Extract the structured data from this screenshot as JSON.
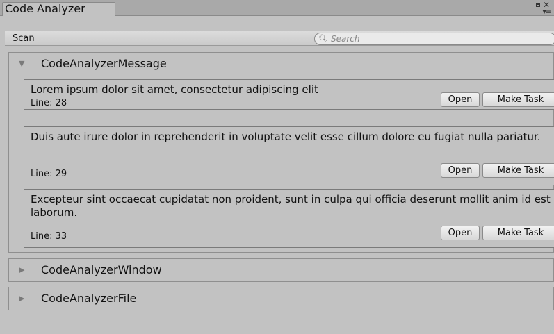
{
  "window": {
    "tab_title": "Code Analyzer",
    "icons": [
      "maximize-icon",
      "close-icon",
      "menu-icon"
    ]
  },
  "toolbar": {
    "scan_label": "Scan",
    "search_placeholder": "Search",
    "search_icon": "search-icon"
  },
  "groups": [
    {
      "title": "CodeAnalyzerMessage",
      "expanded": true,
      "messages": [
        {
          "text": "Lorem ipsum dolor sit amet, consectetur adipiscing elit",
          "line": "Line: 28",
          "open_label": "Open",
          "task_label": "Make Task"
        },
        {
          "text": "Duis aute irure dolor in reprehenderit in voluptate velit esse cillum dolore eu fugiat nulla pariatur.",
          "line": "Line: 29",
          "open_label": "Open",
          "task_label": "Make Task"
        },
        {
          "text": "Excepteur sint occaecat cupidatat non proident, sunt in culpa qui officia deserunt mollit anim id est laborum.",
          "line": "Line: 33",
          "open_label": "Open",
          "task_label": "Make Task"
        }
      ]
    },
    {
      "title": "CodeAnalyzerWindow",
      "expanded": false
    },
    {
      "title": "CodeAnalyzerFile",
      "expanded": false
    }
  ],
  "colors": {
    "background": "#c2c2c2",
    "titlebar": "#a9a9a9",
    "border": "#8f8f8f"
  }
}
